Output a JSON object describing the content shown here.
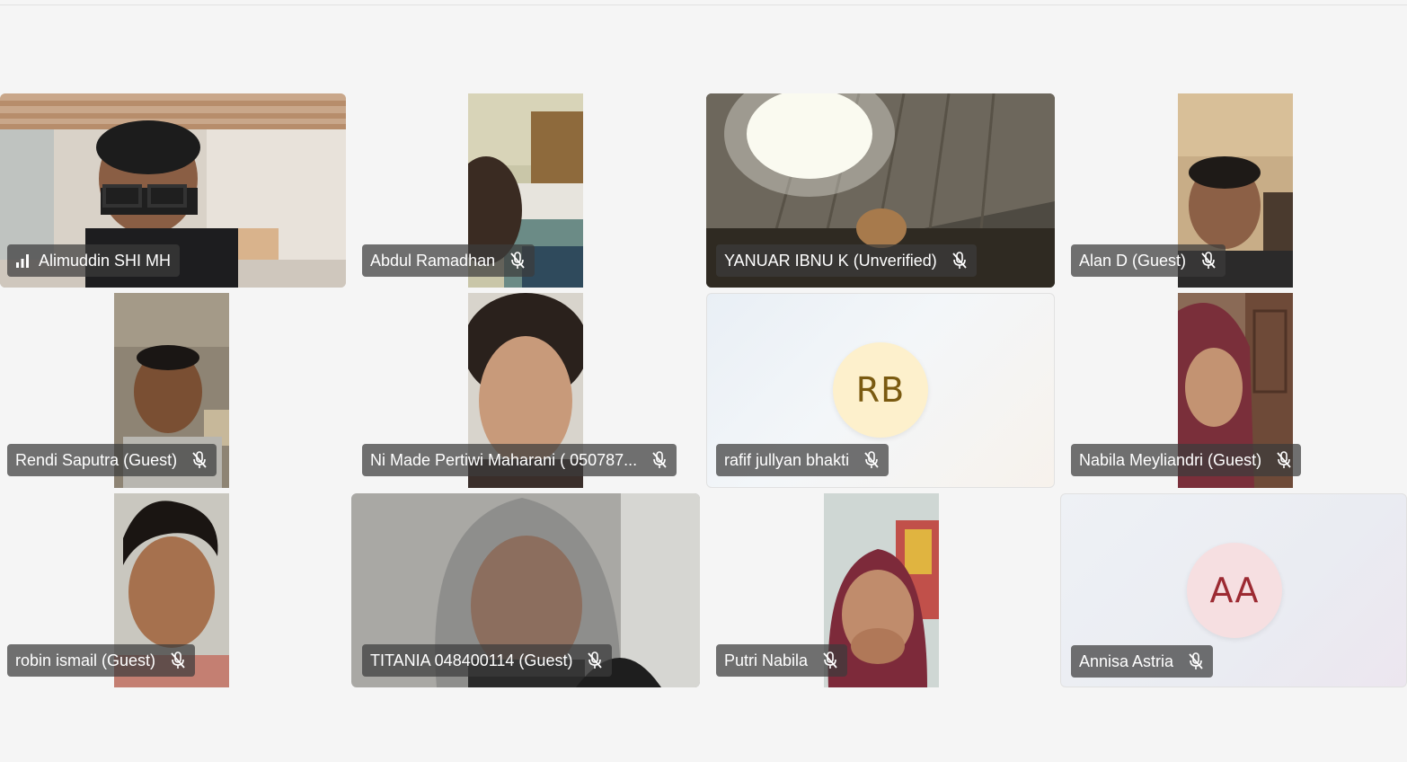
{
  "participants": [
    {
      "name": "Alimuddin SHI MH",
      "muted": false,
      "icon": "signal-bars-icon"
    },
    {
      "name": "Abdul Ramadhan",
      "muted": true,
      "icon": "mic-off-icon"
    },
    {
      "name": "YANUAR IBNU K (Unverified)",
      "muted": true,
      "icon": "mic-off-icon"
    },
    {
      "name": "Alan D (Guest)",
      "muted": true,
      "icon": "mic-off-icon"
    },
    {
      "name": "Rendi Saputra (Guest)",
      "muted": true,
      "icon": "mic-off-icon"
    },
    {
      "name": "Ni Made Pertiwi Maharani ( 050787...",
      "muted": true,
      "icon": "mic-off-icon"
    },
    {
      "name": "rafif jullyan bhakti",
      "initials": "RB",
      "muted": true,
      "icon": "mic-off-icon",
      "avatar_bg": "#fdf0cc",
      "avatar_fg": "#7a5a10"
    },
    {
      "name": "Nabila Meyliandri (Guest)",
      "muted": true,
      "icon": "mic-off-icon"
    },
    {
      "name": "robin ismail (Guest)",
      "muted": true,
      "icon": "mic-off-icon"
    },
    {
      "name": "TITANIA 048400114 (Guest)",
      "muted": true,
      "icon": "mic-off-icon"
    },
    {
      "name": "Putri Nabila",
      "muted": true,
      "icon": "mic-off-icon"
    },
    {
      "name": "Annisa Astria",
      "initials": "AA",
      "muted": true,
      "icon": "mic-off-icon",
      "avatar_bg": "#f6dfe1",
      "avatar_fg": "#9c2a32"
    }
  ]
}
